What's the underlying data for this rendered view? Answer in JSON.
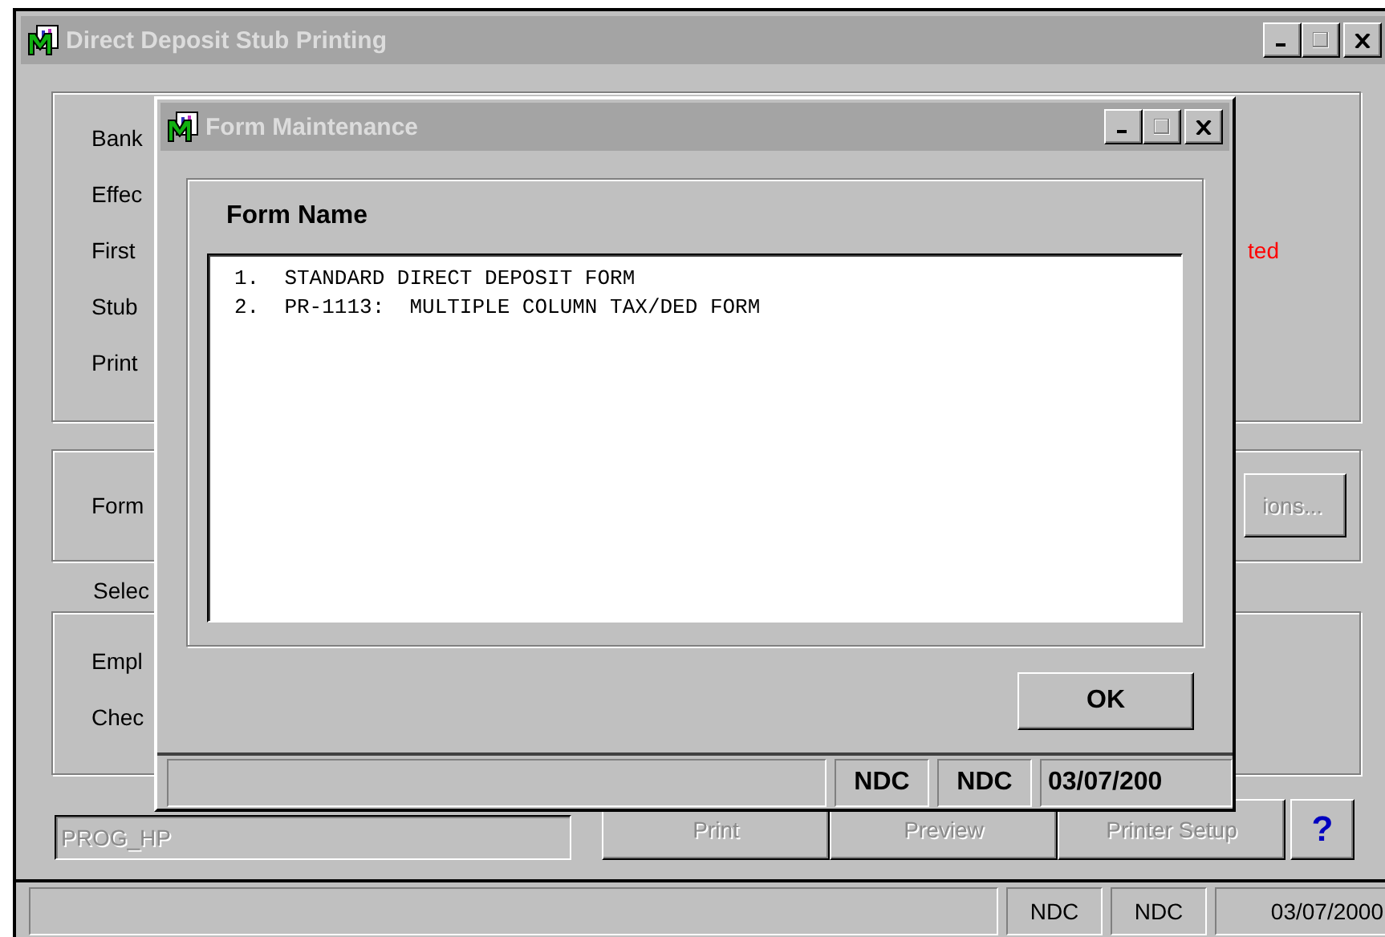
{
  "main_window": {
    "title": "Direct Deposit Stub Printing",
    "fields": [
      {
        "label": "Bank"
      },
      {
        "label": "Effec"
      },
      {
        "label": "First",
        "note": "ted"
      },
      {
        "label": "Stub"
      },
      {
        "label": "Print"
      }
    ],
    "form_section": {
      "label": "Form",
      "button": {
        "label": "ions...",
        "disabled": true
      }
    },
    "select_label": "Selec",
    "select_fields": [
      {
        "label": "Empl"
      },
      {
        "label": "Chec"
      }
    ],
    "printer": {
      "value": "PROG_HP",
      "disabled": true
    },
    "buttons": [
      {
        "kind": "text",
        "label": "Print",
        "disabled": true
      },
      {
        "kind": "text",
        "label": "Preview",
        "disabled": true
      },
      {
        "kind": "text",
        "label": "Printer Setup",
        "disabled": true
      },
      {
        "kind": "help",
        "label": "?",
        "disabled": false
      }
    ],
    "status_bar": [
      "NDC",
      "NDC",
      "03/07/2000"
    ]
  },
  "dialog": {
    "title": "Form Maintenance",
    "heading": "Form Name",
    "items": [
      "1.  STANDARD DIRECT DEPOSIT FORM",
      "2.  PR-1113:  MULTIPLE COLUMN TAX/DED FORM"
    ],
    "ok_button": {
      "label": "OK"
    },
    "status_bar": [
      "NDC",
      "NDC",
      "03/07/200"
    ]
  }
}
